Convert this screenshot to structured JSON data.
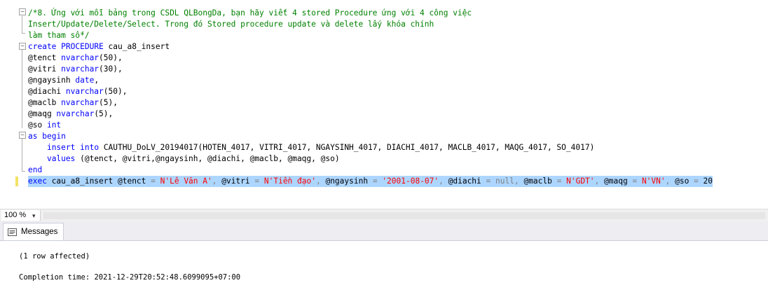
{
  "editor": {
    "lines": [
      "/*8. Ứng với mỗi bảng trong CSDL QLBongDa, bạn hãy viết 4 stored Procedure ứng với 4 công việc",
      "Insert/Update/Delete/Select. Trong đó Stored procedure update và delete lấy khóa chính",
      "làm tham số*/",
      "create PROCEDURE cau_a8_insert",
      "@tenct nvarchar(50),",
      "@vitri nvarchar(30),",
      "@ngaysinh date,",
      "@diachi nvarchar(50),",
      "@maclb nvarchar(5),",
      "@maqg nvarchar(5),",
      "@so int",
      "as begin",
      "    insert into CAUTHU_DoLV_20194017(HOTEN_4017, VITRI_4017, NGAYSINH_4017, DIACHI_4017, MACLB_4017, MAQG_4017, SO_4017)",
      "    values (@tenct, @vitri,@ngaysinh, @diachi, @maclb, @maqg, @so)",
      "end",
      "exec cau_a8_insert @tenct = N'Lê Văn A', @vitri = N'Tiền đạo', @ngaysinh = '2001-08-07', @diachi = null, @maclb = N'GDT', @maqg = N'VN', @so = 20"
    ]
  },
  "zoom": {
    "value": "100 %"
  },
  "results_tab": {
    "label": "Messages"
  },
  "messages": {
    "rows_affected": "(1 row affected)",
    "completion": "Completion time: 2021-12-29T20:52:48.6099095+07:00"
  },
  "colors": {
    "comment": "#008000",
    "keyword": "#0000ff",
    "string": "#ff0000",
    "selection": "#add6ff"
  }
}
